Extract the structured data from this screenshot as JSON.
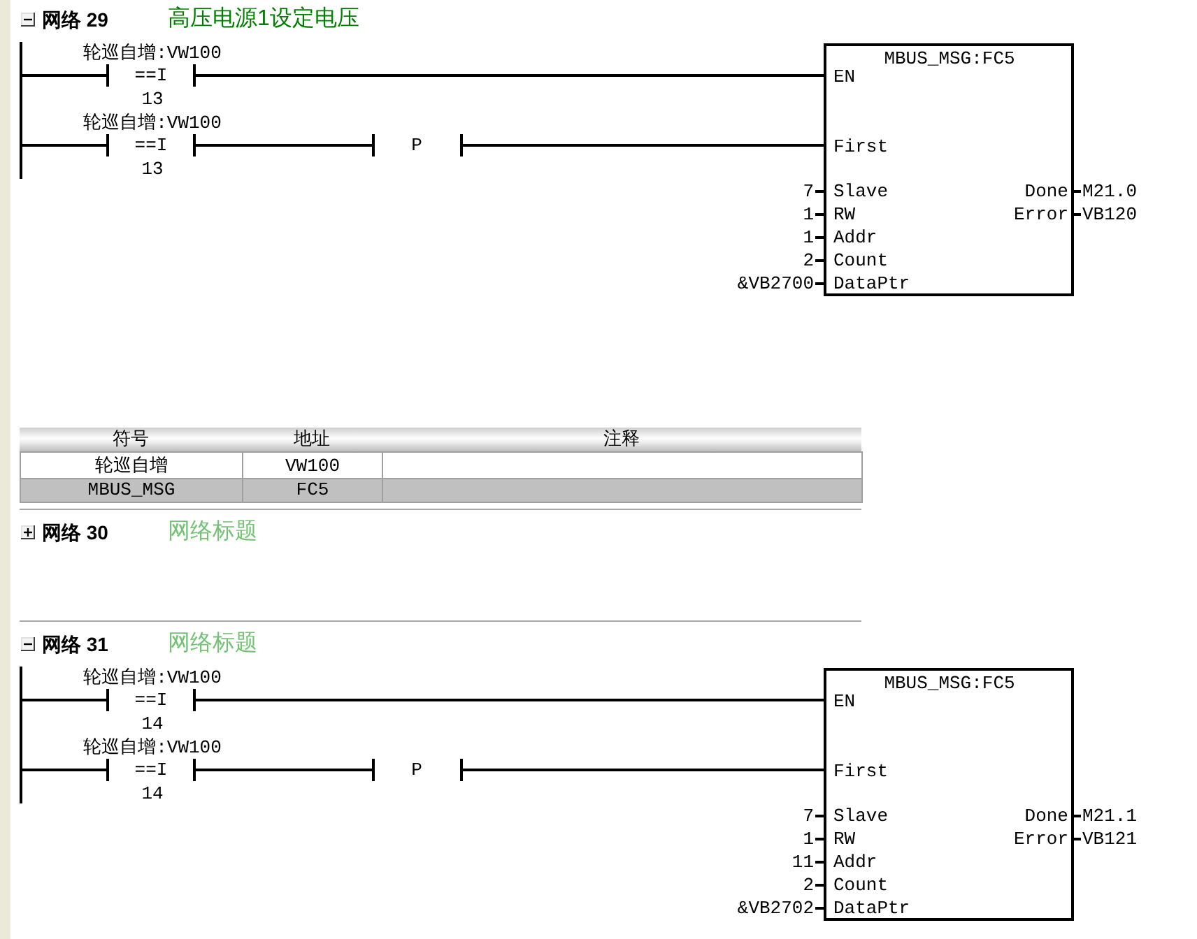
{
  "networks": [
    {
      "label": "网络 29",
      "expanded": true,
      "title": "高压电源1设定电压",
      "title_default": false,
      "ladder": {
        "rungs": [
          {
            "contact": {
              "operand": "轮巡自增:VW100",
              "operator": "==I",
              "value": "13"
            }
          },
          {
            "contact": {
              "operand": "轮巡自增:VW100",
              "operator": "==I",
              "value": "13"
            },
            "edge": "P"
          }
        ],
        "block": {
          "name": "MBUS_MSG:FC5",
          "inputs": [
            {
              "pin": "EN",
              "kind": "rung"
            },
            {
              "pin": "First",
              "kind": "rung"
            },
            {
              "pin": "Slave",
              "kind": "value",
              "value": "7"
            },
            {
              "pin": "RW",
              "kind": "value",
              "value": "1"
            },
            {
              "pin": "Addr",
              "kind": "value",
              "value": "1"
            },
            {
              "pin": "Count",
              "kind": "value",
              "value": "2"
            },
            {
              "pin": "DataPtr",
              "kind": "value",
              "value": "&VB2700"
            }
          ],
          "outputs": [
            {
              "pin": "Done",
              "value": "M21.0"
            },
            {
              "pin": "Error",
              "value": "VB120"
            }
          ]
        }
      },
      "symbol_table": {
        "columns": [
          "符号",
          "地址",
          "注释"
        ],
        "rows": [
          {
            "cells": [
              "轮巡自增",
              "VW100"
            ],
            "selected": false
          },
          {
            "cells": [
              "MBUS_MSG",
              "FC5"
            ],
            "selected": true
          }
        ]
      }
    },
    {
      "label": "网络 30",
      "expanded": false,
      "title": "网络标题",
      "title_default": true
    },
    {
      "label": "网络 31",
      "expanded": true,
      "title": "网络标题",
      "title_default": true,
      "ladder": {
        "rungs": [
          {
            "contact": {
              "operand": "轮巡自增:VW100",
              "operator": "==I",
              "value": "14"
            }
          },
          {
            "contact": {
              "operand": "轮巡自增:VW100",
              "operator": "==I",
              "value": "14"
            },
            "edge": "P"
          }
        ],
        "block": {
          "name": "MBUS_MSG:FC5",
          "inputs": [
            {
              "pin": "EN",
              "kind": "rung"
            },
            {
              "pin": "First",
              "kind": "rung"
            },
            {
              "pin": "Slave",
              "kind": "value",
              "value": "7"
            },
            {
              "pin": "RW",
              "kind": "value",
              "value": "1"
            },
            {
              "pin": "Addr",
              "kind": "value",
              "value": "11"
            },
            {
              "pin": "Count",
              "kind": "value",
              "value": "2"
            },
            {
              "pin": "DataPtr",
              "kind": "value",
              "value": "&VB2702"
            }
          ],
          "outputs": [
            {
              "pin": "Done",
              "value": "M21.1"
            },
            {
              "pin": "Error",
              "value": "VB121"
            }
          ]
        }
      }
    }
  ]
}
